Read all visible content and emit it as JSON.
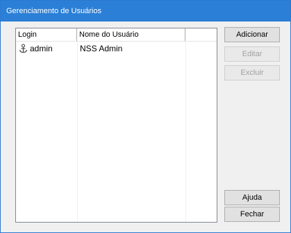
{
  "window": {
    "title": "Gerenciamento de Usuários"
  },
  "list": {
    "columns": [
      "Login",
      "Nome do Usuário",
      ""
    ],
    "rows": [
      {
        "login": "admin",
        "name": "NSS Admin",
        "icon": "user-anchor-icon"
      }
    ]
  },
  "buttons": {
    "add": "Adicionar",
    "edit": "Editar",
    "delete": "Excluir",
    "help": "Ajuda",
    "close": "Fechar"
  },
  "colors": {
    "titlebar": "#2b7fd6",
    "border": "#2b79d0",
    "window_bg": "#f0f0f0"
  }
}
